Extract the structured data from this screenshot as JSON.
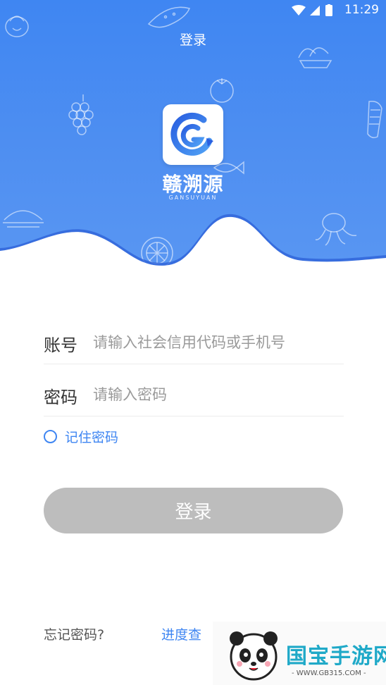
{
  "status_bar": {
    "time": "11:29"
  },
  "header": {
    "title": "登录",
    "brand_cn": "赣溯源",
    "brand_en": "GANSUYUAN"
  },
  "form": {
    "account": {
      "label": "账号",
      "placeholder": "请输入社会信用代码或手机号",
      "value": ""
    },
    "password": {
      "label": "密码",
      "placeholder": "请输入密码",
      "value": ""
    },
    "remember_label": "记住密码",
    "remember_checked": false,
    "login_button": "登录"
  },
  "footer": {
    "forgot_password": "忘记密码?",
    "progress_query": "进度查"
  },
  "watermark": {
    "text": "国宝手游网",
    "url": "- WWW.GB315.COM -"
  },
  "colors": {
    "header_blue": "#4a8af2",
    "accent_blue": "#3f86f2",
    "button_disabled": "#bdbdbd"
  }
}
